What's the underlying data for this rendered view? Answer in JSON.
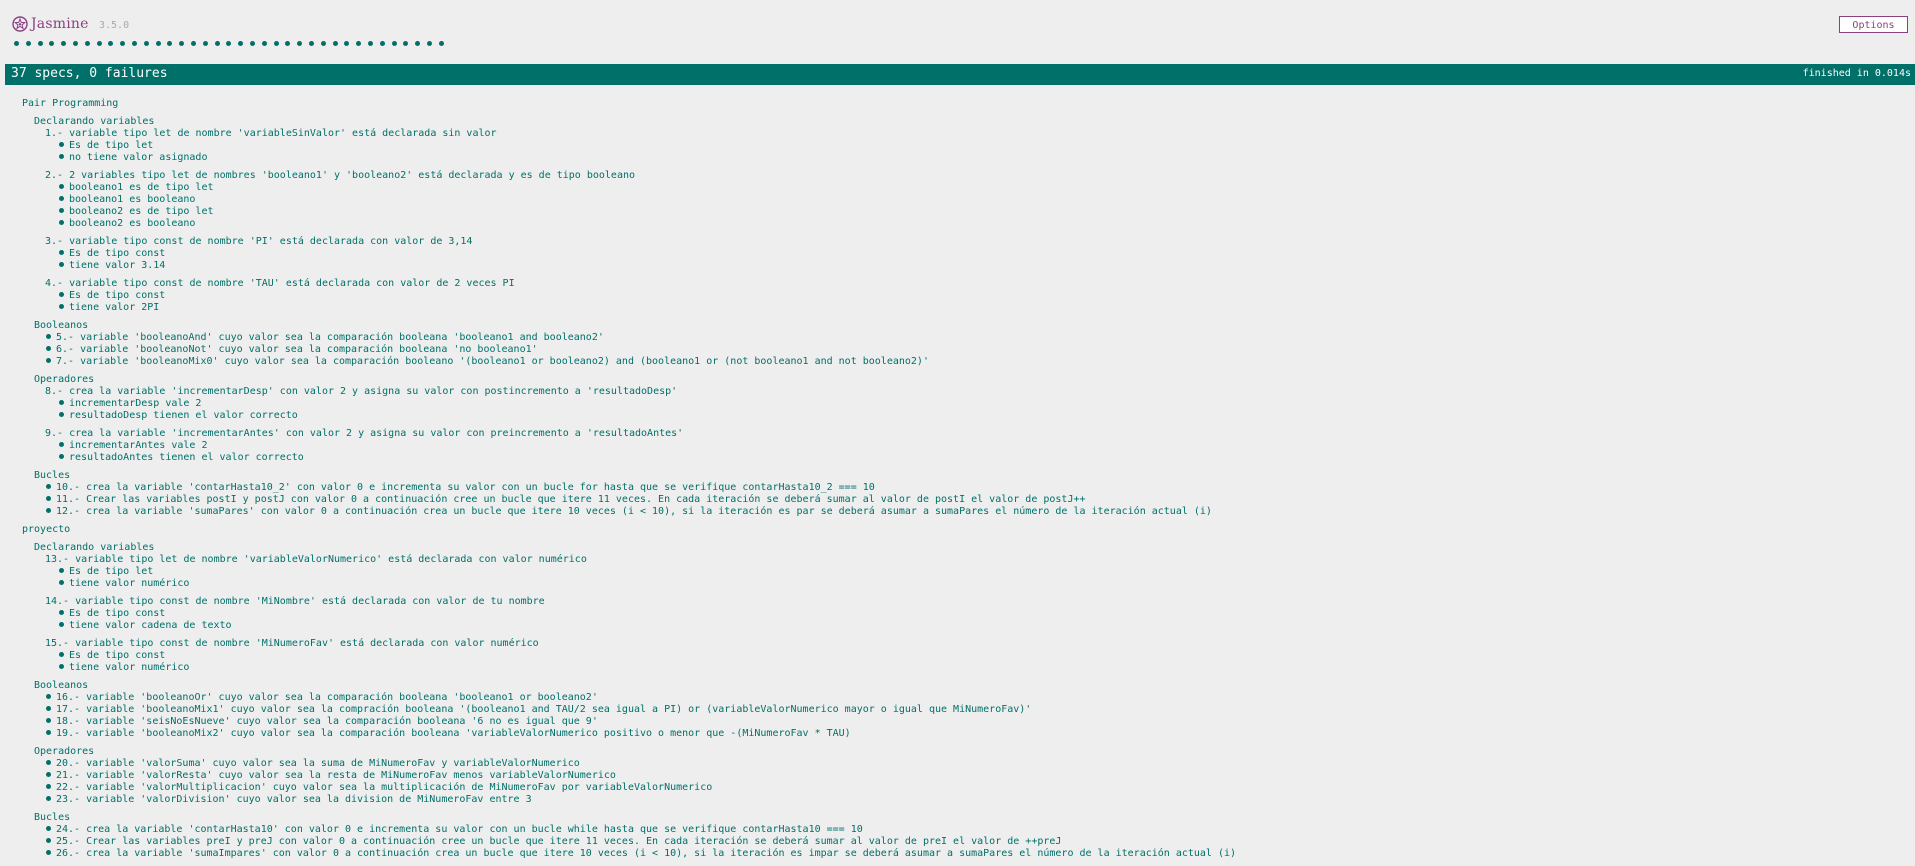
{
  "banner": {
    "title": "Jasmine",
    "version": "3.5.0",
    "options_label": "Options"
  },
  "summary": {
    "overall": "37 specs, 0 failures",
    "duration": "finished in 0.014s",
    "dot_count": 37,
    "accent_color": "#007069"
  },
  "results": [
    {
      "kind": "suite",
      "level": 0,
      "text": "Pair Programming"
    },
    {
      "kind": "suite",
      "level": 1,
      "text": "Declarando variables"
    },
    {
      "kind": "spec",
      "level": 2,
      "text": "1.- variable tipo let de nombre 'variableSinValor' está declarada sin valor"
    },
    {
      "kind": "exp",
      "level": 3,
      "text": "Es de tipo let"
    },
    {
      "kind": "exp",
      "level": 3,
      "text": "no tiene valor asignado"
    },
    {
      "kind": "spec",
      "level": 2,
      "text": "2.- 2 variables tipo let de nombres 'booleano1' y 'booleano2' está declarada y es de tipo booleano"
    },
    {
      "kind": "exp",
      "level": 3,
      "text": "booleano1 es de tipo let"
    },
    {
      "kind": "exp",
      "level": 3,
      "text": "booleano1 es booleano"
    },
    {
      "kind": "exp",
      "level": 3,
      "text": "booleano2 es de tipo let"
    },
    {
      "kind": "exp",
      "level": 3,
      "text": "booleano2 es booleano"
    },
    {
      "kind": "spec",
      "level": 2,
      "text": "3.- variable tipo const de nombre 'PI' está declarada con valor de 3,14"
    },
    {
      "kind": "exp",
      "level": 3,
      "text": "Es de tipo const"
    },
    {
      "kind": "exp",
      "level": 3,
      "text": "tiene valor 3.14"
    },
    {
      "kind": "spec",
      "level": 2,
      "text": "4.- variable tipo const de nombre 'TAU' está declarada con valor de 2 veces PI"
    },
    {
      "kind": "exp",
      "level": 3,
      "text": "Es de tipo const"
    },
    {
      "kind": "exp",
      "level": 3,
      "text": "tiene valor 2PI"
    },
    {
      "kind": "suite",
      "level": 1,
      "text": "Booleanos"
    },
    {
      "kind": "exp",
      "level": 2,
      "text": "5.- variable 'booleanoAnd' cuyo valor sea la comparación booleana 'booleano1 and booleano2'"
    },
    {
      "kind": "exp",
      "level": 2,
      "text": "6.- variable 'booleanoNot' cuyo valor sea la comparación booleana 'no booleano1'"
    },
    {
      "kind": "exp",
      "level": 2,
      "text": "7.- variable 'booleanoMix0' cuyo valor sea la comparación booleano '(booleano1 or booleano2) and (booleano1 or (not booleano1 and not booleano2)'"
    },
    {
      "kind": "suite",
      "level": 1,
      "text": "Operadores"
    },
    {
      "kind": "spec",
      "level": 2,
      "text": "8.- crea la variable 'incrementarDesp' con valor 2 y asigna su valor con postincremento a 'resultadoDesp'"
    },
    {
      "kind": "exp",
      "level": 3,
      "text": "incrementarDesp vale 2"
    },
    {
      "kind": "exp",
      "level": 3,
      "text": "resultadoDesp tienen el valor correcto"
    },
    {
      "kind": "spec",
      "level": 2,
      "text": "9.- crea la variable 'incrementarAntes' con valor 2 y asigna su valor con preincremento a 'resultadoAntes'"
    },
    {
      "kind": "exp",
      "level": 3,
      "text": "incrementarAntes vale 2"
    },
    {
      "kind": "exp",
      "level": 3,
      "text": "resultadoAntes tienen el valor correcto"
    },
    {
      "kind": "suite",
      "level": 1,
      "text": "Bucles"
    },
    {
      "kind": "exp",
      "level": 2,
      "text": "10.- crea la variable 'contarHasta10_2' con valor 0 e incrementa su valor con un bucle for hasta que se verifique contarHasta10_2 === 10"
    },
    {
      "kind": "exp",
      "level": 2,
      "text": "11.- Crear las variables postI y postJ con valor 0 a continuación cree un bucle que itere 11 veces. En cada iteración se deberá sumar al valor de postI el valor de postJ++"
    },
    {
      "kind": "exp",
      "level": 2,
      "text": "12.- crea la variable 'sumaPares' con valor 0 a continuación crea un bucle que itere 10 veces (i < 10), si la iteración es par se deberá asumar a sumaPares el número de la iteración actual (i)"
    },
    {
      "kind": "suite",
      "level": 0,
      "text": "proyecto"
    },
    {
      "kind": "suite",
      "level": 1,
      "text": "Declarando variables"
    },
    {
      "kind": "spec",
      "level": 2,
      "text": "13.- variable tipo let de nombre 'variableValorNumerico' está declarada con valor numérico"
    },
    {
      "kind": "exp",
      "level": 3,
      "text": "Es de tipo let"
    },
    {
      "kind": "exp",
      "level": 3,
      "text": "tiene valor numérico"
    },
    {
      "kind": "spec",
      "level": 2,
      "text": "14.- variable tipo const de nombre 'MiNombre' está declarada con valor de tu nombre"
    },
    {
      "kind": "exp",
      "level": 3,
      "text": "Es de tipo const"
    },
    {
      "kind": "exp",
      "level": 3,
      "text": "tiene valor cadena de texto"
    },
    {
      "kind": "spec",
      "level": 2,
      "text": "15.- variable tipo const de nombre 'MiNumeroFav' está declarada con valor numérico"
    },
    {
      "kind": "exp",
      "level": 3,
      "text": "Es de tipo const"
    },
    {
      "kind": "exp",
      "level": 3,
      "text": "tiene valor numérico"
    },
    {
      "kind": "suite",
      "level": 1,
      "text": "Booleanos"
    },
    {
      "kind": "exp",
      "level": 2,
      "text": "16.- variable 'booleanoOr' cuyo valor sea la comparación booleana 'booleano1 or booleano2'"
    },
    {
      "kind": "exp",
      "level": 2,
      "text": "17.- variable 'booleanoMix1' cuyo valor sea la compración booleana '(booleano1 and TAU/2 sea igual a PI) or (variableValorNumerico mayor o igual que MiNumeroFav)'"
    },
    {
      "kind": "exp",
      "level": 2,
      "text": "18.- variable 'seisNoEsNueve' cuyo valor sea la comparación booleana '6 no es igual que 9'"
    },
    {
      "kind": "exp",
      "level": 2,
      "text": "19.- variable 'booleanoMix2' cuyo valor sea la comparación booleana 'variableValorNumerico positivo o menor que -(MiNumeroFav * TAU)"
    },
    {
      "kind": "suite",
      "level": 1,
      "text": "Operadores"
    },
    {
      "kind": "exp",
      "level": 2,
      "text": "20.- variable 'valorSuma' cuyo valor sea la suma de MiNumeroFav y variableValorNumerico"
    },
    {
      "kind": "exp",
      "level": 2,
      "text": "21.- variable 'valorResta' cuyo valor sea la resta de MiNumeroFav menos variableValorNumerico"
    },
    {
      "kind": "exp",
      "level": 2,
      "text": "22.- variable 'valorMultiplicacion' cuyo valor sea la multiplicación de MiNumeroFav por variableValorNumerico"
    },
    {
      "kind": "exp",
      "level": 2,
      "text": "23.- variable 'valorDivision' cuyo valor sea la division de MiNumeroFav entre 3"
    },
    {
      "kind": "suite",
      "level": 1,
      "text": "Bucles"
    },
    {
      "kind": "exp",
      "level": 2,
      "text": "24.- crea la variable 'contarHasta10' con valor 0 e incrementa su valor con un bucle while hasta que se verifique contarHasta10 === 10"
    },
    {
      "kind": "exp",
      "level": 2,
      "text": "25.- Crear las variables preI y preJ con valor 0 a continuación cree un bucle que itere 11 veces. En cada iteración se deberá sumar al valor de preI el valor de ++preJ"
    },
    {
      "kind": "exp",
      "level": 2,
      "text": "26.- crea la variable 'sumaImpares' con valor 0 a continuación crea un bucle que itere 10 veces (i < 10), si la iteración es impar se deberá asumar a sumaPares el número de la iteración actual (i)"
    }
  ]
}
